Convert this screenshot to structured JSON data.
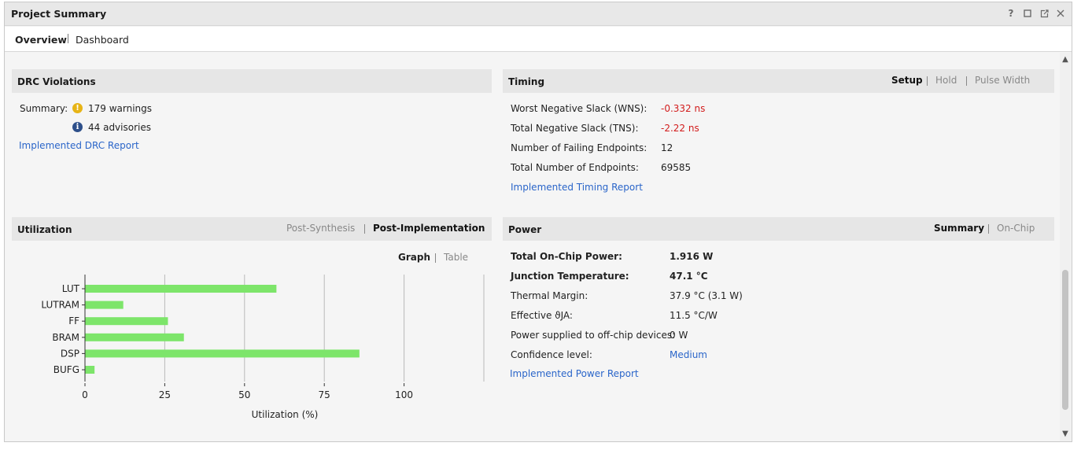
{
  "window": {
    "title": "Project Summary",
    "controls": [
      "help-icon",
      "maximize-icon",
      "float-icon",
      "close-icon"
    ]
  },
  "tabs": [
    {
      "label": "Overview",
      "active": true
    },
    {
      "label": "Dashboard",
      "active": false
    }
  ],
  "drc": {
    "title": "DRC Violations",
    "summary_label": "Summary:",
    "warnings": "179 warnings",
    "advisories": "44 advisories",
    "report_link": "Implemented DRC Report"
  },
  "timing": {
    "title": "Timing",
    "tabs": [
      {
        "label": "Setup",
        "active": true
      },
      {
        "label": "Hold",
        "active": false
      },
      {
        "label": "Pulse Width",
        "active": false
      }
    ],
    "rows": [
      {
        "label": "Worst Negative Slack (WNS):",
        "value": "-0.332 ns",
        "status": "fail"
      },
      {
        "label": "Total Negative Slack (TNS):",
        "value": "-2.22 ns",
        "status": "fail"
      },
      {
        "label": "Number of Failing Endpoints:",
        "value": "12",
        "status": "normal"
      },
      {
        "label": "Total Number of Endpoints:",
        "value": "69585",
        "status": "normal"
      }
    ],
    "report_link": "Implemented Timing Report"
  },
  "utilization": {
    "title": "Utilization",
    "tabs": [
      {
        "label": "Post-Synthesis",
        "active": false
      },
      {
        "label": "Post-Implementation",
        "active": true
      }
    ],
    "view_tabs": [
      {
        "label": "Graph",
        "active": true
      },
      {
        "label": "Table",
        "active": false
      }
    ]
  },
  "power": {
    "title": "Power",
    "tabs": [
      {
        "label": "Summary",
        "active": true
      },
      {
        "label": "On-Chip",
        "active": false
      }
    ],
    "rows": [
      {
        "label": "Total On-Chip Power:",
        "value": "1.916 W",
        "emphasis": true
      },
      {
        "label": "Junction Temperature:",
        "value": "47.1 °C",
        "emphasis": true
      },
      {
        "label": "Thermal Margin:",
        "value": "37.9 °C (3.1 W)",
        "emphasis": false
      },
      {
        "label": "Effective ϑJA:",
        "value": "11.5 °C/W",
        "emphasis": false
      },
      {
        "label": "Power supplied to off-chip devices:",
        "value": "0 W",
        "emphasis": false
      },
      {
        "label": "Confidence level:",
        "value": "Medium",
        "emphasis": false,
        "link": true
      }
    ],
    "report_link": "Implemented Power Report"
  },
  "colors": {
    "bar": "#7de56a",
    "link": "#2a65c9",
    "fail": "#d21c1c",
    "warning": "#e7b416",
    "info": "#2d4f8a"
  },
  "chart_data": {
    "type": "bar",
    "orientation": "horizontal",
    "categories": [
      "LUT",
      "LUTRAM",
      "FF",
      "BRAM",
      "DSP",
      "BUFG"
    ],
    "values": [
      60,
      12,
      26,
      31,
      86,
      3
    ],
    "xlabel": "Utilization (%)",
    "xlim": [
      0,
      125
    ],
    "xticks": [
      0,
      25,
      50,
      75,
      100
    ],
    "grid": true
  }
}
